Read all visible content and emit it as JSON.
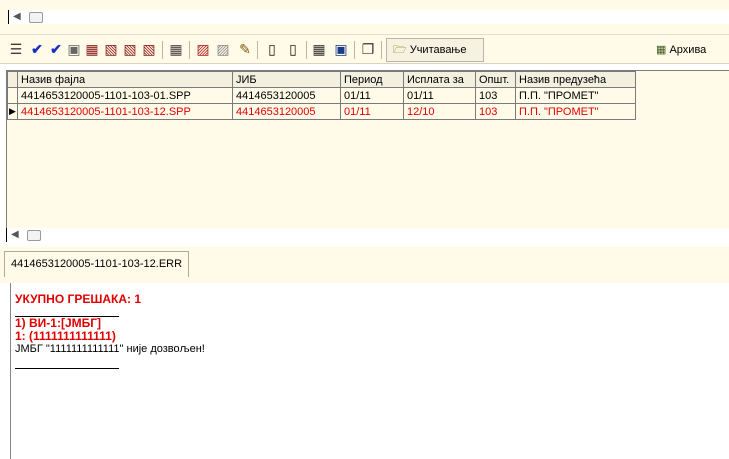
{
  "toolbar": {
    "icons": [
      "tree-icon",
      "check-icon",
      "double-check-icon",
      "document-icon",
      "document-stack-icon",
      "document-arrow-icon",
      "document-arrow-icon",
      "document-arrow-icon",
      "spreadsheet-icon",
      "report-icon",
      "report-copy-icon",
      "edit-icon",
      "page-icon",
      "pages-icon",
      "calendar-icon",
      "screen-icon",
      "copy-icon"
    ],
    "load_label": "Учитавање",
    "archive_label": "Архива"
  },
  "grid": {
    "columns": [
      "Назив фајла",
      "ЈИБ",
      "Период",
      "Исплата за",
      "Општ.",
      "Назив предузећа"
    ],
    "rows": [
      {
        "cells": [
          "4414653120005-1101-103-01.SPP",
          "4414653120005",
          "01/11",
          "01/11",
          "103",
          "П.П. \"ПРОМЕТ\""
        ],
        "selected": false,
        "error": false
      },
      {
        "cells": [
          "4414653120005-1101-103-12.SPP",
          "4414653120005",
          "01/11",
          "12/10",
          "103",
          "П.П. \"ПРОМЕТ\""
        ],
        "selected": true,
        "error": true
      }
    ]
  },
  "tabs": {
    "active": "4414653120005-1101-103-12.ERR"
  },
  "log": {
    "total_errors": "УКУПНО ГРЕШАКА: 1",
    "error_header": "1) ВИ-1:[ЈМБГ]",
    "error_value": "1: (1111111111111)",
    "error_message": "ЈМБГ \"1111111111111\" није дозвољен!"
  },
  "colors": {
    "error": "#e10000",
    "panel_background": "#fffbe8"
  }
}
